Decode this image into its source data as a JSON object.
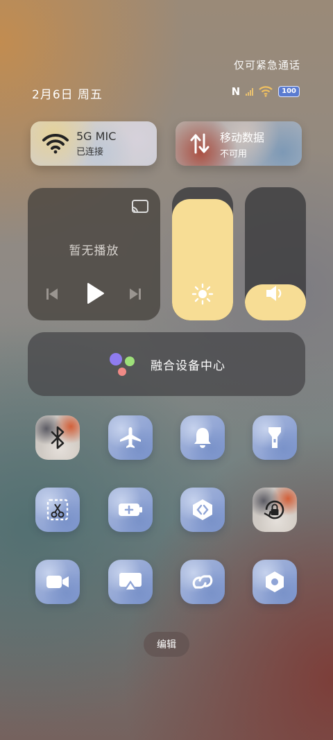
{
  "status_bar": {
    "emergency_text": "仅可紧急通话",
    "date_text": "2月6日 周五",
    "nfc_label": "N",
    "battery_level": "100"
  },
  "wifi_tile": {
    "title": "5G MIC",
    "subtitle": "已连接"
  },
  "mobile_tile": {
    "title": "移动数据",
    "subtitle": "不可用"
  },
  "media": {
    "no_playback": "暂无播放"
  },
  "sliders": {
    "brightness_level": 0.91,
    "volume_level": 0.27
  },
  "hub": {
    "label": "融合设备中心"
  },
  "quick_tiles": [
    {
      "icon": "bluetooth-icon",
      "active": true
    },
    {
      "icon": "airplane-icon",
      "active": false
    },
    {
      "icon": "bell-icon",
      "active": false
    },
    {
      "icon": "flashlight-icon",
      "active": false
    },
    {
      "icon": "screenshot-scissors-icon",
      "active": false
    },
    {
      "icon": "battery-saver-icon",
      "active": false
    },
    {
      "icon": "link-share-icon",
      "active": false
    },
    {
      "icon": "rotation-lock-icon",
      "active": true
    },
    {
      "icon": "screen-record-icon",
      "active": false
    },
    {
      "icon": "screen-cast-icon",
      "active": false
    },
    {
      "icon": "chain-link-icon",
      "active": false
    },
    {
      "icon": "settings-hex-icon",
      "active": false
    }
  ],
  "edit_label": "编辑",
  "colors": {
    "slider_fill": "#f7dd95",
    "tile_blue": "#8fa4d6",
    "battery": "#5a7bd0"
  }
}
